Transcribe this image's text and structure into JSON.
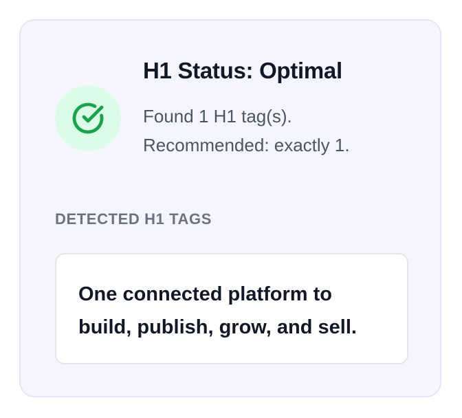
{
  "status": {
    "title": "H1 Status: Optimal",
    "found_text": "Found 1 H1 tag(s).",
    "recommended_text": "Recommended: exactly 1.",
    "icon": "check-circle-icon",
    "icon_color": "#16a34a",
    "icon_bg": "#dcfce7"
  },
  "detected": {
    "label": "DETECTED H1 TAGS",
    "tags": [
      {
        "line1": "One connected platform to",
        "line2": "build, publish, grow, and sell."
      }
    ]
  }
}
